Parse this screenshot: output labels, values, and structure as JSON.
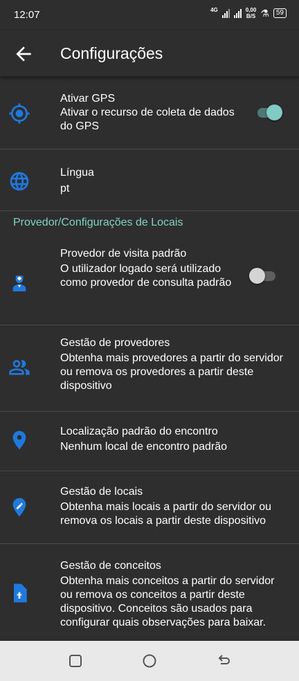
{
  "status": {
    "time": "12:07",
    "network": "4G",
    "rate_top": "0,00",
    "rate_bottom": "B/S",
    "battery": "59"
  },
  "appbar": {
    "title": "Configurações"
  },
  "colors": {
    "accent": "#1f7ae0",
    "section": "#7ed3c3",
    "switch_on": "#80cbc4",
    "background": "#2e2e2e"
  },
  "settings": {
    "gps": {
      "title": "Ativar GPS",
      "summary": "Ativar o recurso de coleta de dados do GPS",
      "enabled": true,
      "icon": "gps-crosshair-icon"
    },
    "language": {
      "title": "Língua",
      "summary": "pt",
      "icon": "globe-icon"
    },
    "section_title": "Provedor/Configurações de Locais",
    "default_provider": {
      "title": "Provedor de visita padrão",
      "summary": "O utilizador logado será utilizado como provedor de consulta padrão",
      "enabled": false,
      "icon": "doctor-icon"
    },
    "provider_management": {
      "title": "Gestão de provedores",
      "summary": "Obtenha mais provedores a partir do servidor ou remova os provedores a partir deste dispositivo",
      "icon": "people-icon"
    },
    "default_location": {
      "title": "Localização padrão do encontro",
      "summary": "Nenhum local de encontro padrão",
      "icon": "location-pin-icon"
    },
    "location_management": {
      "title": "Gestão de locais",
      "summary": "Obtenha mais locais a partir do servidor ou remova os locais a partir deste dispositivo",
      "icon": "edit-location-icon"
    },
    "concept_management": {
      "title": "Gestão de conceitos",
      "summary": "Obtenha mais conceitos a partir do servidor ou remova os conceitos a partir deste dispositivo. Conceitos são usados para configurar quais observações para baixar.",
      "icon": "document-icon"
    }
  },
  "navbar": {
    "buttons": [
      "recents-icon",
      "home-icon",
      "back-nav-icon"
    ]
  }
}
